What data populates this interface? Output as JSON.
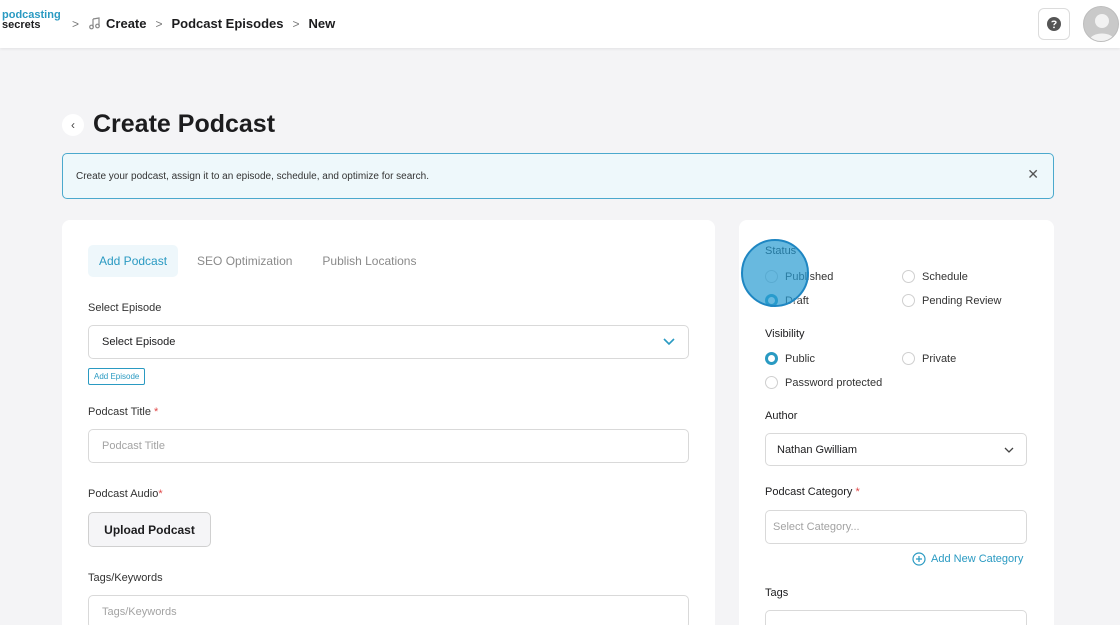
{
  "header": {
    "logo_line1": "podcasting",
    "logo_line2": "secrets",
    "breadcrumb": [
      "Create",
      "Podcast Episodes",
      "New"
    ],
    "help_icon": "question-circle-icon",
    "avatar_icon": "user-avatar-icon"
  },
  "page": {
    "title": "Create Podcast",
    "back_icon": "chevron-left-icon"
  },
  "notice": {
    "text": "Create your podcast, assign it to an episode, schedule, and optimize for search.",
    "close_icon": "close-icon"
  },
  "tabs": [
    {
      "label": "Add Podcast",
      "active": true
    },
    {
      "label": "SEO Optimization",
      "active": false
    },
    {
      "label": "Publish Locations",
      "active": false
    }
  ],
  "form": {
    "select_episode_label": "Select Episode",
    "select_episode_value": "Select Episode",
    "add_episode_label": "Add Episode",
    "podcast_title_label": "Podcast Title",
    "podcast_title_placeholder": "Podcast Title",
    "podcast_audio_label": "Podcast Audio",
    "upload_label": "Upload Podcast",
    "tags_keywords_label": "Tags/Keywords",
    "tags_keywords_placeholder": "Tags/Keywords",
    "required_mark": "*"
  },
  "sidebar": {
    "status_label": "Status",
    "status_options": [
      {
        "label": "Published",
        "selected": false
      },
      {
        "label": "Schedule",
        "selected": false
      },
      {
        "label": "Draft",
        "selected": true
      },
      {
        "label": "Pending Review",
        "selected": false
      }
    ],
    "visibility_label": "Visibility",
    "visibility_options": [
      {
        "label": "Public",
        "selected": true
      },
      {
        "label": "Private",
        "selected": false
      },
      {
        "label": "Password protected",
        "selected": false
      }
    ],
    "author_label": "Author",
    "author_value": "Nathan Gwilliam",
    "category_label": "Podcast Category",
    "category_placeholder": "Select Category...",
    "add_category_label": "Add New Category",
    "tags_label": "Tags"
  },
  "colors": {
    "accent": "#2a9ac2",
    "required": "#e04848",
    "highlight": "#289bd2"
  }
}
